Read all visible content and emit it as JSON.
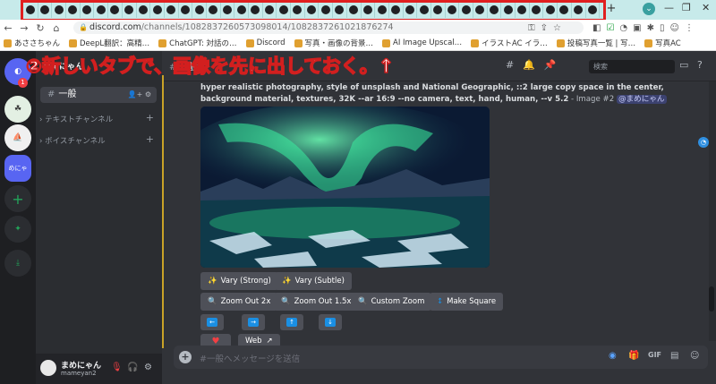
{
  "browser": {
    "tab_count": 41,
    "url_host": "discord.com",
    "url_path": "/channels/1082837260573098014/1082837261021876274",
    "bookmarks": [
      "あささちゃん",
      "DeepL翻訳：高精…",
      "ChatGPT: 対話の…",
      "Discord",
      "写真・画像の背景…",
      "AI Image Upscal…",
      "イラストAC イラ…",
      "投稿写真一覧 | 写…",
      "写真AC"
    ]
  },
  "overlay_text": "②新しいタブで、画像を先に出しておく。↑",
  "server": {
    "name": "まめにゃん",
    "active_channel": "一般",
    "categories": [
      "テキストチャンネル",
      "ボイスチャンネル"
    ],
    "badge": "1"
  },
  "topbar": {
    "channel": "一般",
    "search_placeholder": "検索"
  },
  "message": {
    "prompt": "hyper realistic photography, style of unsplash and National Geographic, ::2 large copy space in the center, background material, textures, 32K --ar 16:9 --no camera, text, hand, human, --v 5.2",
    "meta": " - Image #2 ",
    "mention": "@まめにゃん"
  },
  "buttons": {
    "vary_strong": "Vary (Strong)",
    "vary_subtle": "Vary (Subtle)",
    "zoom2": "Zoom Out 2x",
    "zoom15": "Zoom Out 1.5x",
    "custom_zoom": "Custom Zoom",
    "make_square": "Make Square",
    "web": "Web"
  },
  "input_placeholder": "#一般へメッセージを送信",
  "user": {
    "name": "まめにゃん",
    "tag": "mameyan2"
  },
  "colors": {
    "accent": "#5865f2",
    "button": "#4e5058",
    "overlay_stroke": "#d21f1f",
    "aurora": "#2ee88a"
  }
}
